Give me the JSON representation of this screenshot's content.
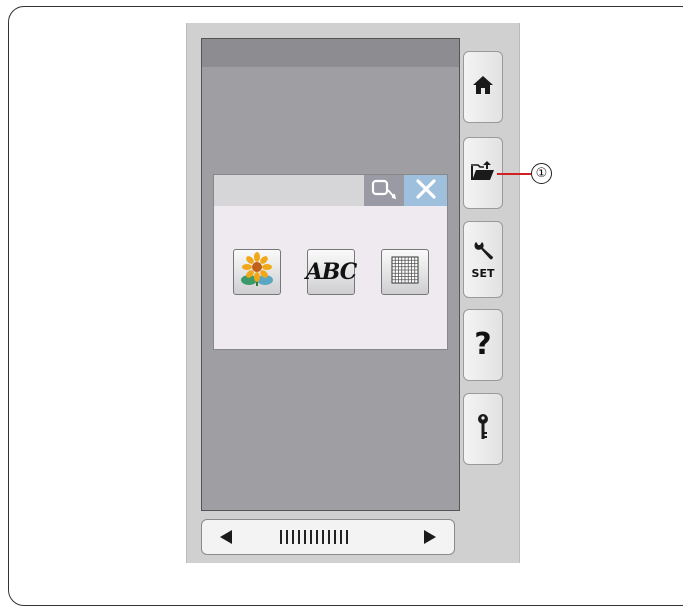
{
  "callout": {
    "number": "①"
  },
  "dialog": {
    "buttons": [
      {
        "label": "ABC"
      }
    ]
  },
  "sidebar": {
    "set_label": "SET",
    "help_label": "?"
  },
  "icons": {
    "home": "home-icon",
    "open_file": "open-file-icon",
    "settings": "wrench-icon",
    "help": "help-icon",
    "key": "key-icon",
    "hoop": "hoop-icon",
    "close": "close-icon",
    "flower": "flower-design-icon",
    "grid": "grid-icon",
    "scroll_left": "left-arrow-icon",
    "scroll_right": "right-arrow-icon"
  },
  "colors": {
    "screen": "#9f9fa3",
    "dialog": "#eeeaf0",
    "close_button": "#9fc0dc",
    "callout_line": "#d02020"
  }
}
